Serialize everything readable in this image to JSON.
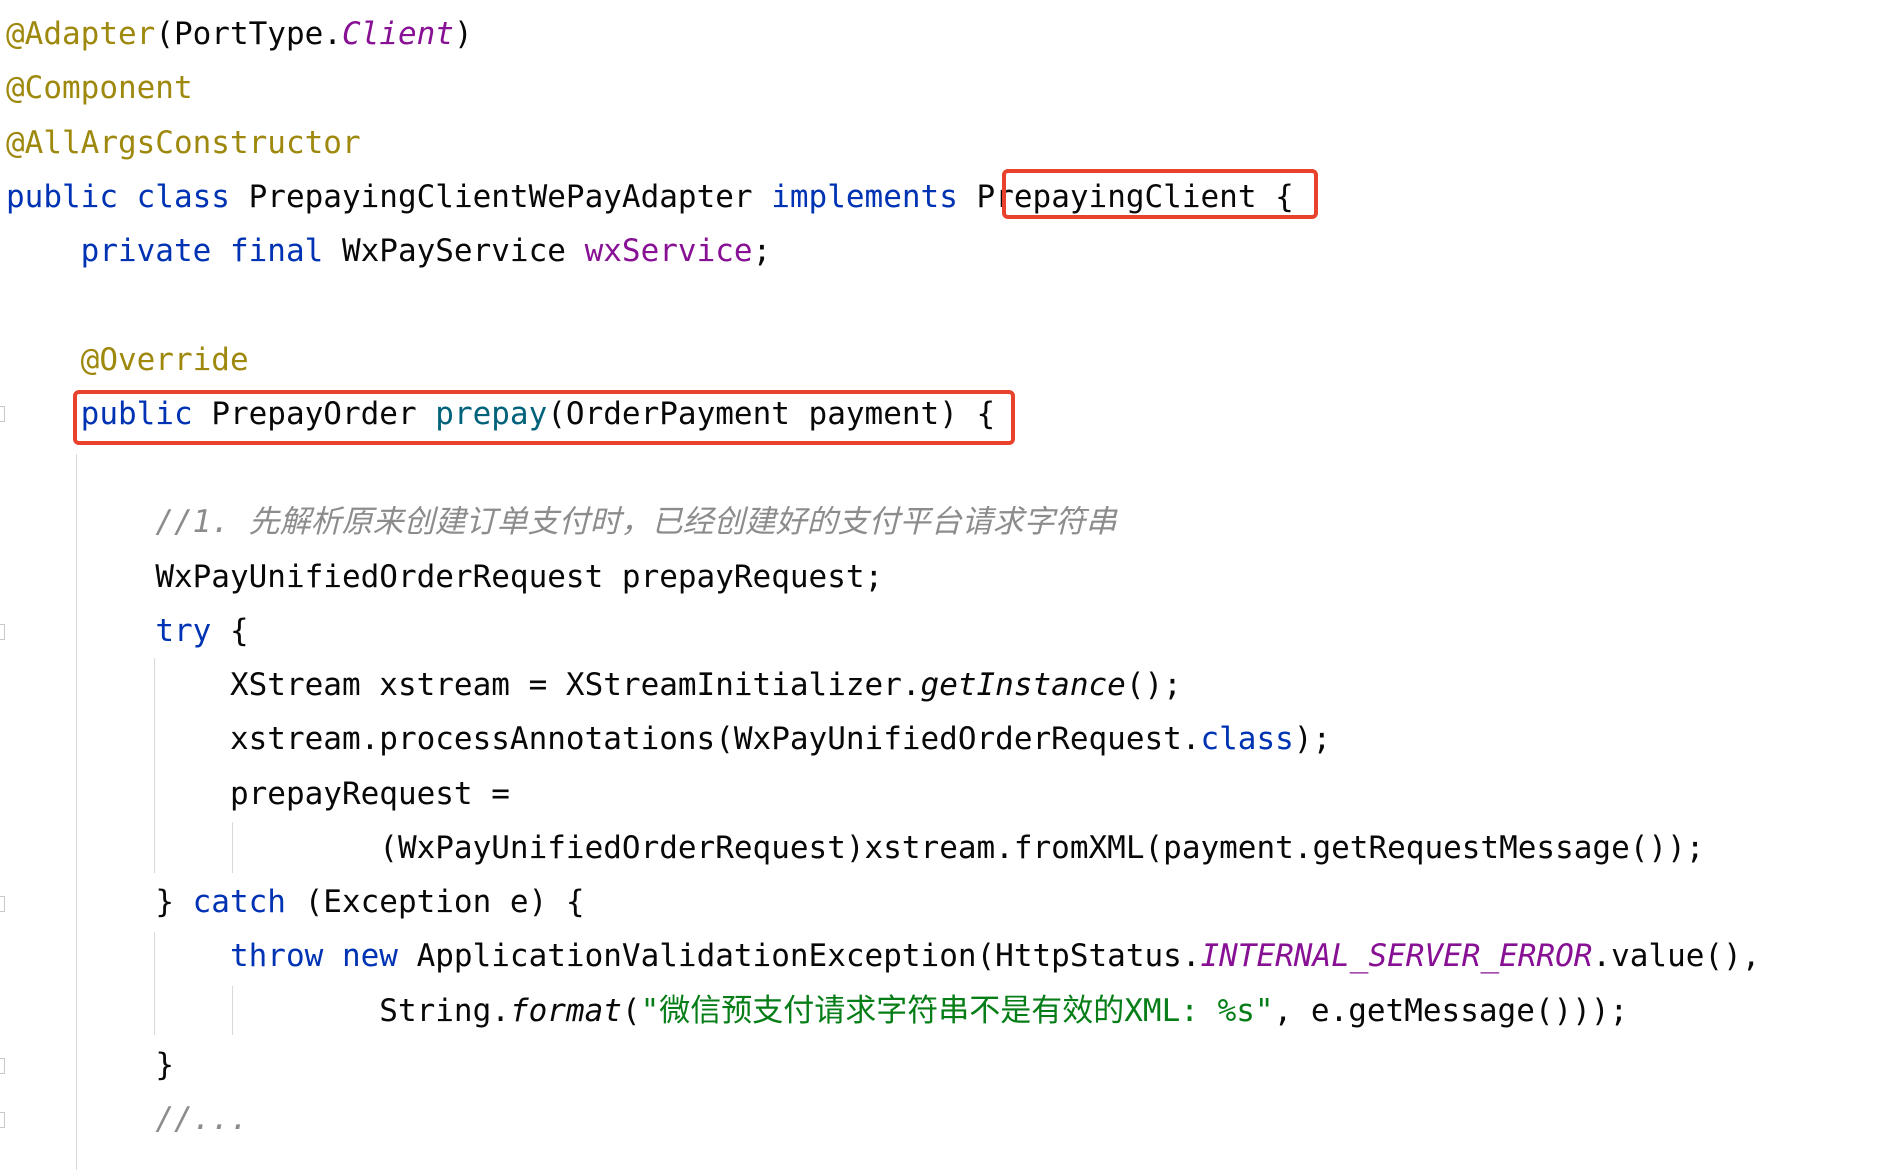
{
  "editor": {
    "lines": [
      [
        {
          "t": "@Adapter",
          "c": "ann"
        },
        {
          "t": "(PortType.",
          "c": "plain"
        },
        {
          "t": "Client",
          "c": "fld ital"
        },
        {
          "t": ")",
          "c": "plain"
        }
      ],
      [
        {
          "t": "@Component",
          "c": "ann"
        }
      ],
      [
        {
          "t": "@AllArgsConstructor",
          "c": "ann"
        }
      ],
      [
        {
          "t": "public class ",
          "c": "kw"
        },
        {
          "t": "PrepayingClientWePayAdapter ",
          "c": "plain"
        },
        {
          "t": "implements ",
          "c": "kw"
        },
        {
          "t": "PrepayingClient ",
          "c": "plain"
        },
        {
          "t": "{",
          "c": "plain"
        }
      ],
      [
        {
          "t": "    ",
          "c": "plain"
        },
        {
          "t": "private final ",
          "c": "kw"
        },
        {
          "t": "WxPayService ",
          "c": "plain"
        },
        {
          "t": "wxService",
          "c": "fld"
        },
        {
          "t": ";",
          "c": "plain"
        }
      ],
      [],
      [
        {
          "t": "    ",
          "c": "plain"
        },
        {
          "t": "@Override",
          "c": "ann"
        }
      ],
      [
        {
          "t": "    ",
          "c": "plain"
        },
        {
          "t": "public ",
          "c": "kw"
        },
        {
          "t": "PrepayOrder ",
          "c": "plain"
        },
        {
          "t": "prepay",
          "c": "fn"
        },
        {
          "t": "(OrderPayment payment) {",
          "c": "plain"
        }
      ],
      [],
      [
        {
          "t": "        ",
          "c": "plain"
        },
        {
          "t": "//1. 先解析原来创建订单支付时，已经创建好的支付平台请求字符串",
          "c": "cmt"
        }
      ],
      [
        {
          "t": "        ",
          "c": "plain"
        },
        {
          "t": "WxPayUnifiedOrderRequest prepayRequest;",
          "c": "plain"
        }
      ],
      [
        {
          "t": "        ",
          "c": "plain"
        },
        {
          "t": "try ",
          "c": "kw"
        },
        {
          "t": "{",
          "c": "plain"
        }
      ],
      [
        {
          "t": "            ",
          "c": "plain"
        },
        {
          "t": "XStream xstream = XStreamInitializer.",
          "c": "plain"
        },
        {
          "t": "getInstance",
          "c": "ital"
        },
        {
          "t": "();",
          "c": "plain"
        }
      ],
      [
        {
          "t": "            ",
          "c": "plain"
        },
        {
          "t": "xstream.processAnnotations(WxPayUnifiedOrderRequest.",
          "c": "plain"
        },
        {
          "t": "class",
          "c": "kw"
        },
        {
          "t": ");",
          "c": "plain"
        }
      ],
      [
        {
          "t": "            ",
          "c": "plain"
        },
        {
          "t": "prepayRequest =",
          "c": "plain"
        }
      ],
      [
        {
          "t": "                    ",
          "c": "plain"
        },
        {
          "t": "(WxPayUnifiedOrderRequest)xstream.fromXML(payment.getRequestMessage());",
          "c": "plain"
        }
      ],
      [
        {
          "t": "        ",
          "c": "plain"
        },
        {
          "t": "} ",
          "c": "plain"
        },
        {
          "t": "catch ",
          "c": "kw"
        },
        {
          "t": "(Exception e) {",
          "c": "plain"
        }
      ],
      [
        {
          "t": "            ",
          "c": "plain"
        },
        {
          "t": "throw new ",
          "c": "kw"
        },
        {
          "t": "ApplicationValidationException(HttpStatus.",
          "c": "plain"
        },
        {
          "t": "INTERNAL_SERVER_ERROR",
          "c": "fld ital"
        },
        {
          "t": ".value(),",
          "c": "plain"
        }
      ],
      [
        {
          "t": "                    ",
          "c": "plain"
        },
        {
          "t": "String.",
          "c": "plain"
        },
        {
          "t": "format",
          "c": "ital"
        },
        {
          "t": "(",
          "c": "plain"
        },
        {
          "t": "\"微信预支付请求字符串不是有效的XML: %s\"",
          "c": "str"
        },
        {
          "t": ", e.getMessage()));",
          "c": "plain"
        }
      ],
      [
        {
          "t": "        ",
          "c": "plain"
        },
        {
          "t": "}",
          "c": "plain"
        }
      ],
      [
        {
          "t": "        ",
          "c": "plain"
        },
        {
          "t": "//...",
          "c": "cmt"
        }
      ]
    ]
  },
  "highlights": {
    "color": "#e8412c"
  }
}
